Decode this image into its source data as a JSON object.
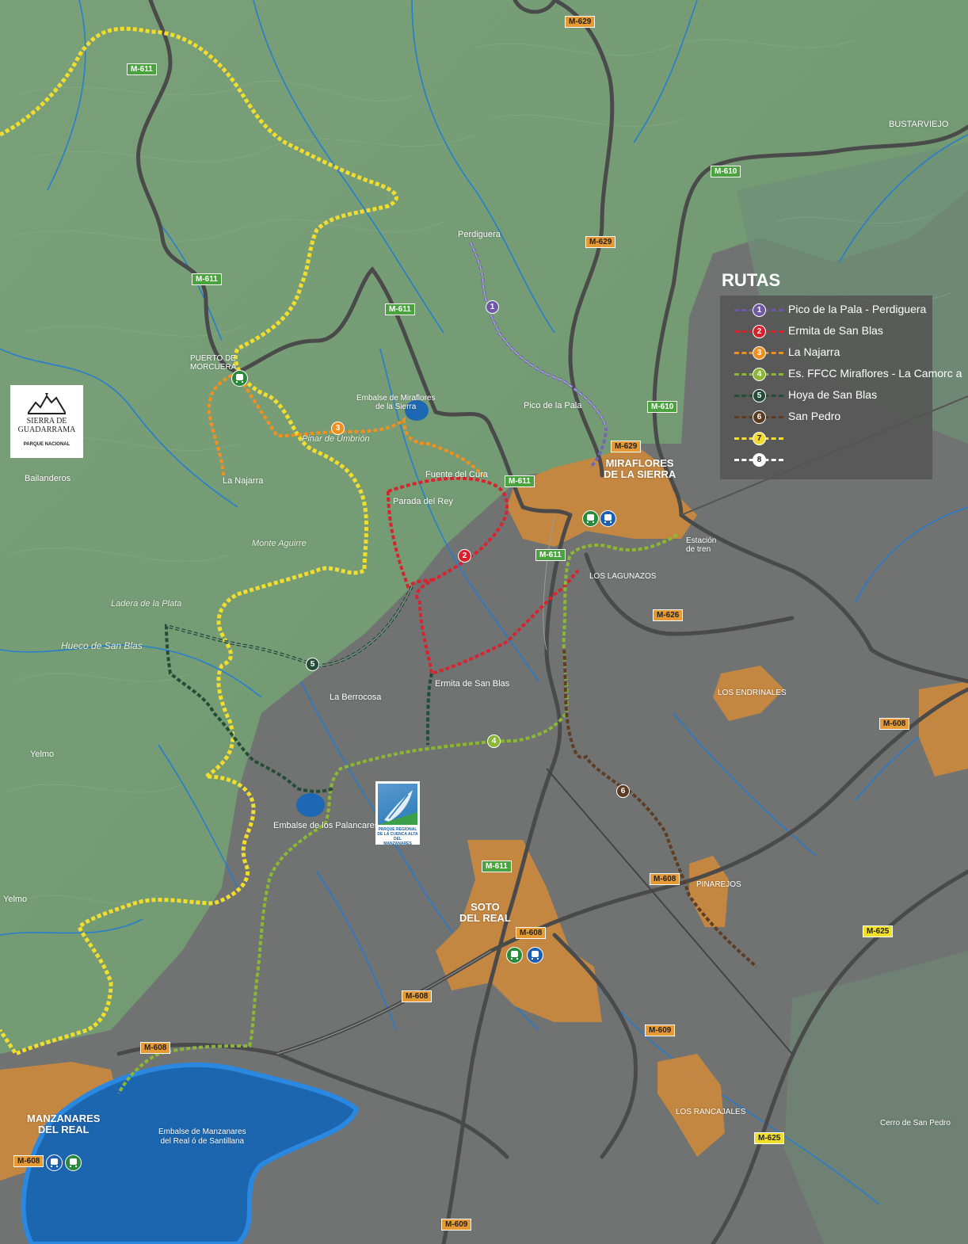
{
  "legend": {
    "title": "RUTAS",
    "routes": [
      {
        "num": "1",
        "name": "Pico de la Pala - Perdiguera",
        "color": "#6f58a6"
      },
      {
        "num": "2",
        "name": "Ermita de San Blas",
        "color": "#d91f2a"
      },
      {
        "num": "3",
        "name": "La Najarra",
        "color": "#f08e1e"
      },
      {
        "num": "4",
        "name": "Es. FFCC Miraflores  - La Camorc a",
        "color": "#8ab535"
      },
      {
        "num": "5",
        "name": "Hoya de San Blas",
        "color": "#234d36"
      },
      {
        "num": "6",
        "name": "San Pedro",
        "color": "#5b3a22"
      },
      {
        "num": "7",
        "name": "",
        "color": "#f2dd2e"
      },
      {
        "num": "8",
        "name": "",
        "color": "#ffffff"
      }
    ]
  },
  "roads": {
    "m629_top": "M-629",
    "m611_a": "M-611",
    "m611_b": "M-611",
    "m611_c": "M-611",
    "m611_d": "M-611",
    "m611_e": "M-611",
    "m611_f": "M-611",
    "m610_a": "M-610",
    "m610_b": "M-610",
    "m629_b": "M-629",
    "m629_c": "M-629",
    "m626": "M-626",
    "m608_a": "M-608",
    "m608_b": "M-608",
    "m608_c": "M-608",
    "m608_d": "M-608",
    "m608_e": "M-608",
    "m608_f": "M-608",
    "m625_a": "M-625",
    "m625_b": "M-625",
    "m609_a": "M-609",
    "m609_b": "M-609"
  },
  "places": {
    "bustarviejo": "BUSTARVIEJO",
    "perdiguera": "Perdiguera",
    "puerto": "PUERTO DE\nMORCUERA",
    "embalse_miraflores": "Embalse de Miraflores\nde la Sierra",
    "pico_pala": "Pico de la Pala",
    "miraflores": "MIRAFLORES\nDE LA SIERRA",
    "pinar": "Pinar de Umbrión",
    "fuente_cura": "Fuente del Cura",
    "parada_rey": "Parada del Rey",
    "la_najarra": "La Najarra",
    "bailanderos": "Bailanderos",
    "monte_aguirre": "Monte Aguirre",
    "estacion": "Estación\nde tren",
    "lagunazos": "LOS LAGUNAZOS",
    "ladera": "Ladera de la Plata",
    "hueco": "Hueco de San Blas",
    "ermita": "Ermita de San Blas",
    "berrocosa": "La Berrocosa",
    "endrinales": "LOS ENDRINALES",
    "yelmo_1": "Yelmo",
    "yelmo_2": "Yelmo",
    "embalse_palancares": "Embalse de los Palancares",
    "pinarejos": "PINAREJOS",
    "soto": "SOTO\nDEL REAL",
    "manzanares": "MANZANARES\nDEL REAL",
    "embalse_santillana": "Embalse de Manzanares\ndel Real ó de Santillana",
    "rancajales": "LOS RANCAJALES",
    "cerro": "Cerro de San Pedro"
  },
  "markers": {
    "m1": "1",
    "m2": "2",
    "m3": "3",
    "m4": "4",
    "m5": "5",
    "m6": "6"
  },
  "logos": {
    "guadarrama_name": "SIERRA DE\nGUADARRAMA",
    "guadarrama_sub": "PARQUE NACIONAL",
    "parque_regional": "PARQUE REGIONAL\nDE LA CUENCA ALTA DEL\nMANZANARES"
  },
  "transit_icons": [
    "bus-icon",
    "train-icon"
  ]
}
